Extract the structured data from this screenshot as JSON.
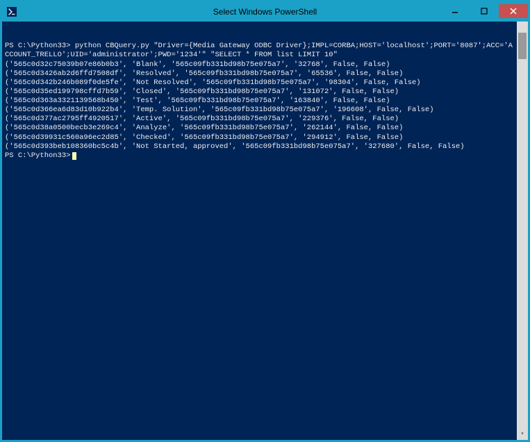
{
  "window": {
    "title": "Select Windows PowerShell"
  },
  "prompt1": {
    "path": "PS C:\\Python33>",
    "cmd": " python CBQuery.py \"Driver={Media Gateway ODBC Driver};IMPL=CORBA;HOST='localhost';PORT='8087';ACC='ACCOUNT_TRELLO';UID='administrator';PWD='1234'\" \"SELECT * FROM list LIMIT 10\""
  },
  "rows": [
    "('565c0d32c75039b07e86b0b3', 'Blank', '565c09fb331bd98b75e075a7', '32768', False, False)",
    "('565c0d3426ab2d6ffd7508df', 'Resolved', '565c09fb331bd98b75e075a7', '65536', False, False)",
    "('565c0d342b246b089f0de5fe', 'Not Resolved', '565c09fb331bd98b75e075a7', '98304', False, False)",
    "('565c0d35ed199798cffd7b59', 'Closed', '565c09fb331bd98b75e075a7', '131072', False, False)",
    "('565c0d363a3321139568b450', 'Test', '565c09fb331bd98b75e075a7', '163840', False, False)",
    "('565c0d366ea6d83d10b922b4', 'Temp. Solution', '565c09fb331bd98b75e075a7', '196608', False, False)",
    "('565c0d377ac2795ff4920517', 'Active', '565c09fb331bd98b75e075a7', '229376', False, False)",
    "('565c0d38a0500becb3e269c4', 'Analyze', '565c09fb331bd98b75e075a7', '262144', False, False)",
    "('565c0d39931c560a96ec2d85', 'Checked', '565c09fb331bd98b75e075a7', '294912', False, False)",
    "('565c0d393beb108360bc5c4b', 'Not Started, approved', '565c09fb331bd98b75e075a7', '327680', False, False)"
  ],
  "prompt2": {
    "path": "PS C:\\Python33>"
  },
  "colors": {
    "terminal_bg": "#012456",
    "terminal_fg": "#eeedf0",
    "window_frame": "#1ba1c7",
    "close_btn": "#c75050",
    "cursor": "#fdfdb0"
  }
}
